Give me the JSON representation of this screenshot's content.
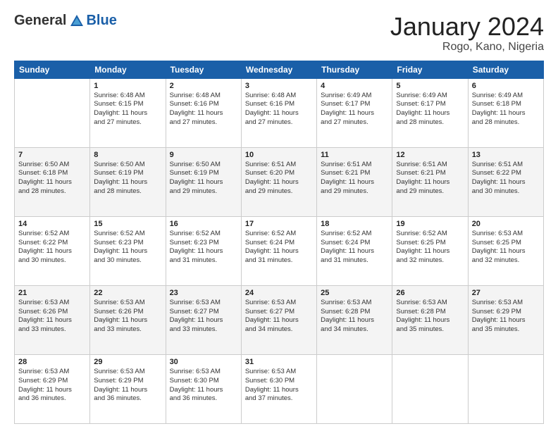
{
  "header": {
    "logo_general": "General",
    "logo_blue": "Blue",
    "month_title": "January 2024",
    "location": "Rogo, Kano, Nigeria"
  },
  "calendar": {
    "days_of_week": [
      "Sunday",
      "Monday",
      "Tuesday",
      "Wednesday",
      "Thursday",
      "Friday",
      "Saturday"
    ],
    "weeks": [
      [
        {
          "day": "",
          "info": ""
        },
        {
          "day": "1",
          "info": "Sunrise: 6:48 AM\nSunset: 6:15 PM\nDaylight: 11 hours\nand 27 minutes."
        },
        {
          "day": "2",
          "info": "Sunrise: 6:48 AM\nSunset: 6:16 PM\nDaylight: 11 hours\nand 27 minutes."
        },
        {
          "day": "3",
          "info": "Sunrise: 6:48 AM\nSunset: 6:16 PM\nDaylight: 11 hours\nand 27 minutes."
        },
        {
          "day": "4",
          "info": "Sunrise: 6:49 AM\nSunset: 6:17 PM\nDaylight: 11 hours\nand 27 minutes."
        },
        {
          "day": "5",
          "info": "Sunrise: 6:49 AM\nSunset: 6:17 PM\nDaylight: 11 hours\nand 28 minutes."
        },
        {
          "day": "6",
          "info": "Sunrise: 6:49 AM\nSunset: 6:18 PM\nDaylight: 11 hours\nand 28 minutes."
        }
      ],
      [
        {
          "day": "7",
          "info": "Sunrise: 6:50 AM\nSunset: 6:18 PM\nDaylight: 11 hours\nand 28 minutes."
        },
        {
          "day": "8",
          "info": "Sunrise: 6:50 AM\nSunset: 6:19 PM\nDaylight: 11 hours\nand 28 minutes."
        },
        {
          "day": "9",
          "info": "Sunrise: 6:50 AM\nSunset: 6:19 PM\nDaylight: 11 hours\nand 29 minutes."
        },
        {
          "day": "10",
          "info": "Sunrise: 6:51 AM\nSunset: 6:20 PM\nDaylight: 11 hours\nand 29 minutes."
        },
        {
          "day": "11",
          "info": "Sunrise: 6:51 AM\nSunset: 6:21 PM\nDaylight: 11 hours\nand 29 minutes."
        },
        {
          "day": "12",
          "info": "Sunrise: 6:51 AM\nSunset: 6:21 PM\nDaylight: 11 hours\nand 29 minutes."
        },
        {
          "day": "13",
          "info": "Sunrise: 6:51 AM\nSunset: 6:22 PM\nDaylight: 11 hours\nand 30 minutes."
        }
      ],
      [
        {
          "day": "14",
          "info": "Sunrise: 6:52 AM\nSunset: 6:22 PM\nDaylight: 11 hours\nand 30 minutes."
        },
        {
          "day": "15",
          "info": "Sunrise: 6:52 AM\nSunset: 6:23 PM\nDaylight: 11 hours\nand 30 minutes."
        },
        {
          "day": "16",
          "info": "Sunrise: 6:52 AM\nSunset: 6:23 PM\nDaylight: 11 hours\nand 31 minutes."
        },
        {
          "day": "17",
          "info": "Sunrise: 6:52 AM\nSunset: 6:24 PM\nDaylight: 11 hours\nand 31 minutes."
        },
        {
          "day": "18",
          "info": "Sunrise: 6:52 AM\nSunset: 6:24 PM\nDaylight: 11 hours\nand 31 minutes."
        },
        {
          "day": "19",
          "info": "Sunrise: 6:52 AM\nSunset: 6:25 PM\nDaylight: 11 hours\nand 32 minutes."
        },
        {
          "day": "20",
          "info": "Sunrise: 6:53 AM\nSunset: 6:25 PM\nDaylight: 11 hours\nand 32 minutes."
        }
      ],
      [
        {
          "day": "21",
          "info": "Sunrise: 6:53 AM\nSunset: 6:26 PM\nDaylight: 11 hours\nand 33 minutes."
        },
        {
          "day": "22",
          "info": "Sunrise: 6:53 AM\nSunset: 6:26 PM\nDaylight: 11 hours\nand 33 minutes."
        },
        {
          "day": "23",
          "info": "Sunrise: 6:53 AM\nSunset: 6:27 PM\nDaylight: 11 hours\nand 33 minutes."
        },
        {
          "day": "24",
          "info": "Sunrise: 6:53 AM\nSunset: 6:27 PM\nDaylight: 11 hours\nand 34 minutes."
        },
        {
          "day": "25",
          "info": "Sunrise: 6:53 AM\nSunset: 6:28 PM\nDaylight: 11 hours\nand 34 minutes."
        },
        {
          "day": "26",
          "info": "Sunrise: 6:53 AM\nSunset: 6:28 PM\nDaylight: 11 hours\nand 35 minutes."
        },
        {
          "day": "27",
          "info": "Sunrise: 6:53 AM\nSunset: 6:29 PM\nDaylight: 11 hours\nand 35 minutes."
        }
      ],
      [
        {
          "day": "28",
          "info": "Sunrise: 6:53 AM\nSunset: 6:29 PM\nDaylight: 11 hours\nand 36 minutes."
        },
        {
          "day": "29",
          "info": "Sunrise: 6:53 AM\nSunset: 6:29 PM\nDaylight: 11 hours\nand 36 minutes."
        },
        {
          "day": "30",
          "info": "Sunrise: 6:53 AM\nSunset: 6:30 PM\nDaylight: 11 hours\nand 36 minutes."
        },
        {
          "day": "31",
          "info": "Sunrise: 6:53 AM\nSunset: 6:30 PM\nDaylight: 11 hours\nand 37 minutes."
        },
        {
          "day": "",
          "info": ""
        },
        {
          "day": "",
          "info": ""
        },
        {
          "day": "",
          "info": ""
        }
      ]
    ]
  }
}
